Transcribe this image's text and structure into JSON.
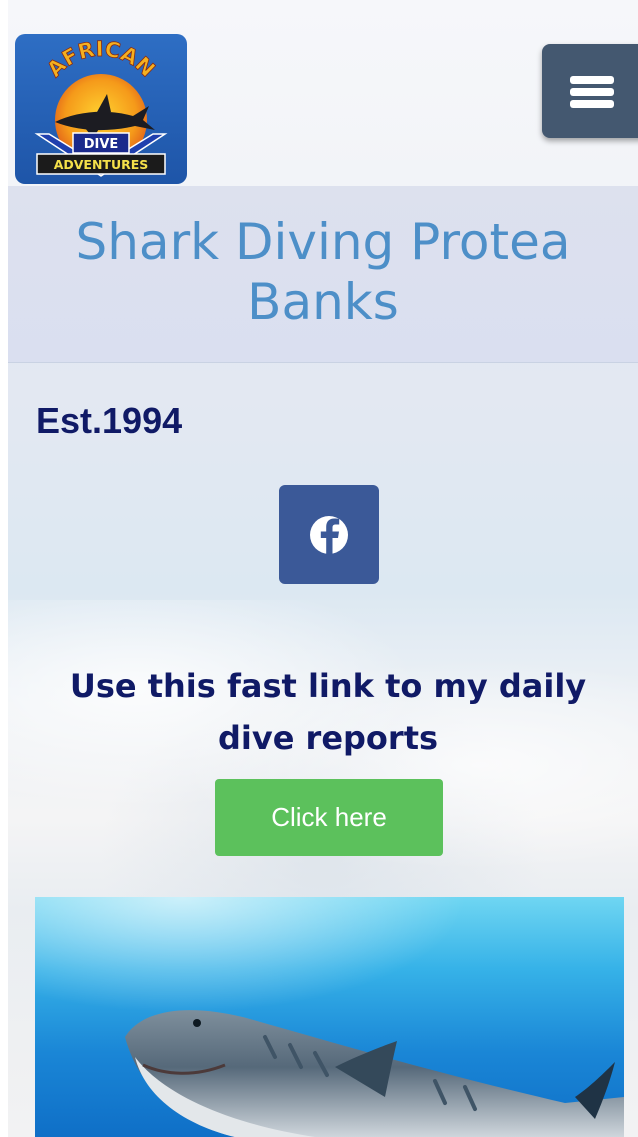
{
  "header": {
    "logo": {
      "top_text": "AFRICAN",
      "line1": "DIVE",
      "line2": "ADVENTURES"
    },
    "menu_icon": "hamburger-menu-icon"
  },
  "main": {
    "title": "Shark Diving Protea Banks",
    "established": "Est.1994",
    "facebook_icon": "facebook-icon",
    "reports_text": "Use this fast link to my daily dive reports",
    "cta_label": "Click here"
  },
  "colors": {
    "title": "#4d8fc8",
    "dark_text": "#101a66",
    "menu_button": "#445870",
    "facebook": "#3b5998",
    "cta_button": "#5cc15c"
  }
}
